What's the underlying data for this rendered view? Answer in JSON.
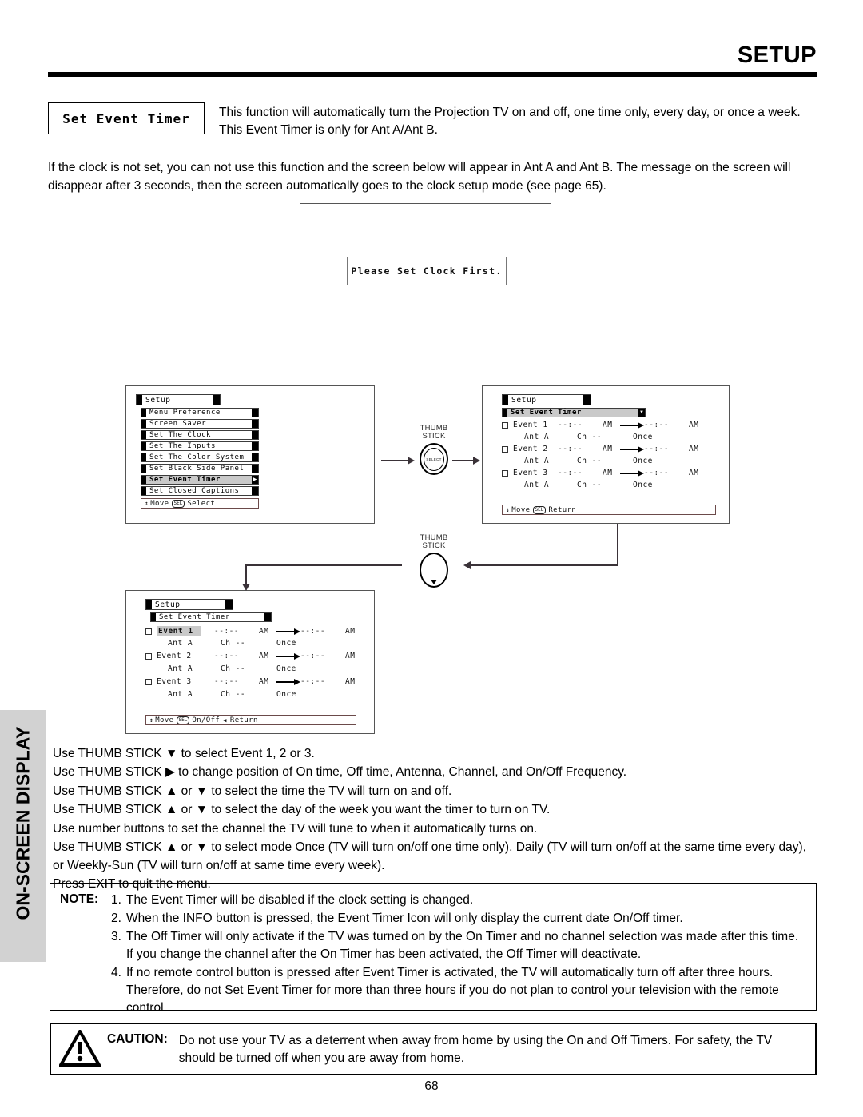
{
  "header": {
    "title": "SETUP"
  },
  "side_tab": {
    "label": "ON-SCREEN DISPLAY"
  },
  "intro": {
    "feature_box_label": "Set Event Timer",
    "description": "This function will automatically turn the Projection TV on and off, one time only, every day, or once a week.  This Event Timer is only for Ant A/Ant B.",
    "clock_note": "If the clock is not set, you can not use this function and the screen below will appear in Ant A and Ant B.  The message on the screen will disappear after 3 seconds, then the screen automatically goes to the clock setup mode (see page 65)."
  },
  "tv_screen": {
    "message": "Please Set Clock First."
  },
  "panel_setup": {
    "title": "Setup",
    "items": [
      "Menu Preference",
      "Screen Saver",
      "Set The Clock",
      "Set The Inputs",
      "Set The Color System",
      "Set Black Side Panel",
      "Set Event Timer",
      "Set Closed Captions"
    ],
    "selected_index": 6,
    "footer_move": "Move",
    "footer_key": "SEL",
    "footer_action": "Select"
  },
  "panel_timer_readonly": {
    "title": "Setup",
    "submenu_title": "Set Event Timer",
    "events": [
      {
        "name": "Event 1",
        "on_time": "--:--",
        "on_ampm": "AM",
        "off_time": "--:--",
        "off_ampm": "AM",
        "antenna": "Ant A",
        "channel": "Ch --",
        "frequency": "Once"
      },
      {
        "name": "Event 2",
        "on_time": "--:--",
        "on_ampm": "AM",
        "off_time": "--:--",
        "off_ampm": "AM",
        "antenna": "Ant A",
        "channel": "Ch --",
        "frequency": "Once"
      },
      {
        "name": "Event 3",
        "on_time": "--:--",
        "on_ampm": "AM",
        "off_time": "--:--",
        "off_ampm": "AM",
        "antenna": "Ant A",
        "channel": "Ch --",
        "frequency": "Once"
      }
    ],
    "footer_move": "Move",
    "footer_key": "SEL",
    "footer_action": "Return"
  },
  "panel_timer_edit": {
    "title": "Setup",
    "submenu_title": "Set Event Timer",
    "selected_event_index": 0,
    "events": [
      {
        "name": "Event 1",
        "on_time": "--:--",
        "on_ampm": "AM",
        "off_time": "--:--",
        "off_ampm": "AM",
        "antenna": "Ant A",
        "channel": "Ch --",
        "frequency": "Once"
      },
      {
        "name": "Event 2",
        "on_time": "--:--",
        "on_ampm": "AM",
        "off_time": "--:--",
        "off_ampm": "AM",
        "antenna": "Ant A",
        "channel": "Ch --",
        "frequency": "Once"
      },
      {
        "name": "Event 3",
        "on_time": "--:--",
        "on_ampm": "AM",
        "off_time": "--:--",
        "off_ampm": "AM",
        "antenna": "Ant A",
        "channel": "Ch --",
        "frequency": "Once"
      }
    ],
    "footer_move": "Move",
    "footer_key": "SEL",
    "footer_action": "On/Off",
    "footer_action2": "Return"
  },
  "thumb_stick": {
    "label_line1": "THUMB",
    "label_line2": "STICK",
    "select_text": "SELECT"
  },
  "instructions": [
    "Use THUMB STICK ▼ to select Event 1, 2 or 3.",
    "Use THUMB STICK ▶ to change position of On time, Off time, Antenna, Channel, and On/Off Frequency.",
    "Use THUMB STICK ▲ or ▼ to select the time the TV will turn on and off.",
    "Use THUMB STICK ▲ or ▼ to select the day of the week you want the timer to turn on TV.",
    "Use number buttons to set the channel the TV will tune to when it automatically turns on.",
    "Use THUMB STICK ▲ or ▼ to select mode Once (TV will turn on/off one time only), Daily (TV will turn on/off at the same time every day), or Weekly-Sun (TV will turn on/off at same time every week).",
    "Press EXIT to quit the menu."
  ],
  "note": {
    "label": "NOTE:",
    "items": [
      {
        "num": "1.",
        "text": "The Event Timer will be disabled if the clock setting is changed."
      },
      {
        "num": "2.",
        "text": "When the INFO button is pressed, the Event Timer Icon will only display the current date On/Off timer."
      },
      {
        "num": "3.",
        "text": "The Off Timer will only activate if the TV was turned on by the On Timer and no channel selection was made after this time.  If you change the channel after the On Timer has been activated, the Off Timer will deactivate."
      },
      {
        "num": "4.",
        "text": "If no remote control button is pressed after Event Timer is activated, the TV will automatically turn off after three hours.  Therefore, do not Set Event Timer for more than three hours if you do not plan to control your television with the remote control."
      }
    ]
  },
  "caution": {
    "label": "CAUTION:",
    "text": "Do not use your TV as a deterrent when away from home by using the On and Off Timers.  For safety, the TV should be turned off when you are away from home."
  },
  "page_number": "68"
}
